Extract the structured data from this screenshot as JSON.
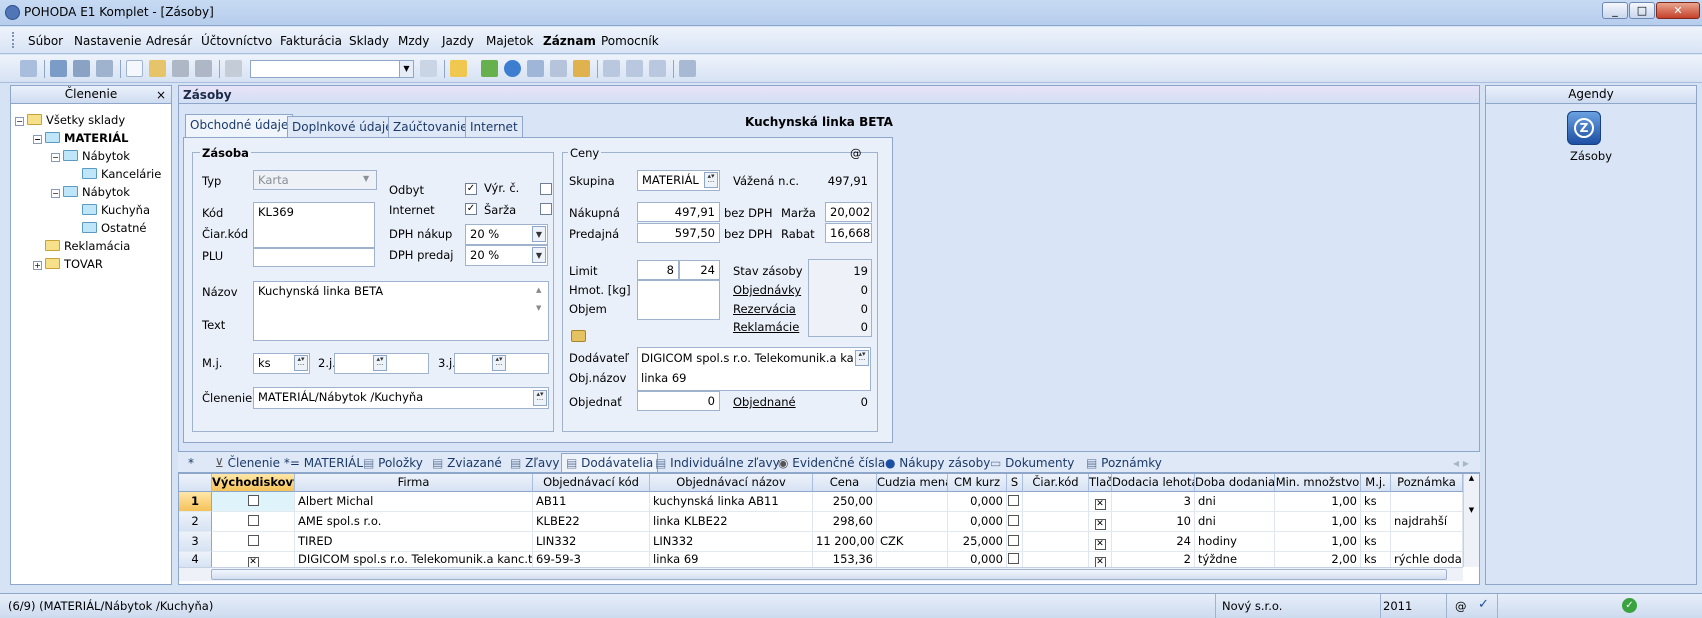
{
  "window": {
    "title": "POHODA E1 Komplet - [Zásoby]",
    "controls": [
      "_",
      "□",
      "✕"
    ]
  },
  "menu": [
    {
      "label": "Súbor",
      "bold": false
    },
    {
      "label": "Nastavenie",
      "bold": false
    },
    {
      "label": "Adresár",
      "bold": false
    },
    {
      "label": "Účtovníctvo",
      "bold": false
    },
    {
      "label": "Fakturácia",
      "bold": false
    },
    {
      "label": "Sklady",
      "bold": false
    },
    {
      "label": "Mzdy",
      "bold": false
    },
    {
      "label": "Jazdy",
      "bold": false
    },
    {
      "label": "Majetok",
      "bold": false
    },
    {
      "label": "Záznam",
      "bold": true
    },
    {
      "label": "Pomocník",
      "bold": false
    }
  ],
  "toolbar": {
    "combo_value": ""
  },
  "tree": {
    "title": "Členenie",
    "close": "×",
    "nodes": [
      {
        "label": "Všetky sklady",
        "bold": false
      },
      {
        "label": "MATERIÁL",
        "bold": true
      },
      {
        "label": "Nábytok",
        "bold": false
      },
      {
        "label": "Kancelárie",
        "bold": false
      },
      {
        "label": "Nábytok",
        "bold": false
      },
      {
        "label": "Kuchyňa",
        "bold": false
      },
      {
        "label": "Ostatné",
        "bold": false
      },
      {
        "label": "Reklamácia",
        "bold": false
      },
      {
        "label": "TOVAR",
        "bold": false
      }
    ]
  },
  "agenda": {
    "title": "Zásoby",
    "item_name": "Kuchynská linka BETA"
  },
  "tabs": [
    "Obchodné údaje",
    "Doplnkové údaje",
    "Zaúčtovanie",
    "Internet"
  ],
  "form": {
    "section_zasoba": "Zásoba",
    "typ_label": "Typ",
    "typ_value": "Karta",
    "kod_label": "Kód",
    "kod_value": "KL369",
    "ciar_label": "Čiar.kód",
    "plu_label": "PLU",
    "odbyt_label": "Odbyt",
    "internet_label": "Internet",
    "vyr_label": "Výr. č.",
    "sarza_label": "Šarža",
    "dph_nakup_label": "DPH nákup",
    "dph_nakup_value": "20 %",
    "dph_predaj_label": "DPH predaj",
    "dph_predaj_value": "20 %",
    "nazov_label": "Názov",
    "nazov_value": "Kuchynská linka BETA",
    "text_label": "Text",
    "mj_label": "M.j.",
    "mj_value": "ks",
    "mj2_label": "2.j.",
    "mj3_label": "3.j.",
    "clenenie_label": "Členenie",
    "clenenie_value": "MATERIÁL/Nábytok /Kuchyňa",
    "section_ceny": "Ceny",
    "at": "@",
    "skupina_label": "Skupina",
    "skupina_value": "MATERIÁL",
    "vazena_label": "Vážená n.c.",
    "vazena_value": "497,91",
    "nakupna_label": "Nákupná",
    "nakupna_value": "497,91",
    "predajna_label": "Predajná",
    "predajna_value": "597,50",
    "bez_dph": "bez DPH",
    "marza_label": "Marža",
    "marza_value": "20,002",
    "rabat_label": "Rabat",
    "rabat_value": "16,668",
    "limit_label": "Limit",
    "limit_min": "8",
    "limit_max": "24",
    "hmot_label": "Hmot. [kg]",
    "objem_label": "Objem",
    "stav_label": "Stav zásoby",
    "stav_value": "19",
    "objednavky_label": "Objednávky",
    "objednavky_value": "0",
    "rezervacia_label": "Rezervácia",
    "rezervacia_value": "0",
    "reklamacie_label": "Reklamácie",
    "reklamacie_value": "0",
    "dodavatel_label": "Dodávateľ",
    "dodavatel_value": "DIGICOM spol.s r.o. Telekomunik.a kanc",
    "objnazov_label": "Obj.názov",
    "objnazov_value": "linka 69",
    "objednat_label": "Objednať",
    "objednat_value": "0",
    "objednane_label": "Objednané",
    "objednane_value": "0"
  },
  "subtabs": [
    {
      "label": "*",
      "active": false
    },
    {
      "label": "Členenie *= MATERIÁL",
      "active": false
    },
    {
      "label": "Položky",
      "active": false
    },
    {
      "label": "Zviazané",
      "active": false
    },
    {
      "label": "Zľavy",
      "active": false
    },
    {
      "label": "Dodávatelia",
      "active": true
    },
    {
      "label": "Individuálne zľavy",
      "active": false
    },
    {
      "label": "Evidenčné čísla",
      "active": false
    },
    {
      "label": "Nákupy zásoby",
      "active": false
    },
    {
      "label": "Dokumenty",
      "active": false
    },
    {
      "label": "Poznámky",
      "active": false
    }
  ],
  "grid": {
    "columns": [
      "Východiskový",
      "Firma",
      "Objednávací kód",
      "Objednávací názov",
      "Cena",
      "Cudzia mena",
      "CM kurz",
      "S",
      "Čiar.kód",
      "Tlač",
      "Dodacia lehota",
      "Doba dodania",
      "Min. množstvo",
      "M.j.",
      "Poznámka"
    ],
    "rows": [
      {
        "n": "1",
        "def": false,
        "firma": "Albert Michal",
        "kod": "AB11",
        "nazov": "kuchynská linka AB11",
        "cena": "250,00",
        "mena": "",
        "kurz": "0,000",
        "s": false,
        "ciar": "",
        "tlac": true,
        "lehota": "3",
        "doba": "dni",
        "min": "1,00",
        "mj": "ks",
        "pozn": ""
      },
      {
        "n": "2",
        "def": false,
        "firma": "AME spol.s r.o.",
        "kod": "KLBE22",
        "nazov": "linka KLBE22",
        "cena": "298,60",
        "mena": "",
        "kurz": "0,000",
        "s": false,
        "ciar": "",
        "tlac": true,
        "lehota": "10",
        "doba": "dni",
        "min": "1,00",
        "mj": "ks",
        "pozn": "najdrahší"
      },
      {
        "n": "3",
        "def": false,
        "firma": "TIRED",
        "kod": "LIN332",
        "nazov": "LIN332",
        "cena": "11 200,00",
        "mena": "CZK",
        "kurz": "25,000",
        "s": false,
        "ciar": "",
        "tlac": true,
        "lehota": "24",
        "doba": "hodiny",
        "min": "1,00",
        "mj": "ks",
        "pozn": ""
      },
      {
        "n": "4",
        "def": true,
        "firma": "DIGICOM spol.s r.o. Telekomunik.a kanc.techn",
        "kod": "69-59-3",
        "nazov": "linka 69",
        "cena": "153,36",
        "mena": "",
        "kurz": "0,000",
        "s": false,
        "ciar": "",
        "tlac": true,
        "lehota": "2",
        "doba": "týždne",
        "min": "2,00",
        "mj": "ks",
        "pozn": "rýchle dodanie"
      }
    ]
  },
  "rightpane": {
    "title": "Agendy",
    "item": "Zásoby"
  },
  "status": {
    "left": "(6/9) (MATERIÁL/Nábytok /Kuchyňa)",
    "company": "Nový s.r.o.",
    "year": "2011",
    "at": "@"
  }
}
